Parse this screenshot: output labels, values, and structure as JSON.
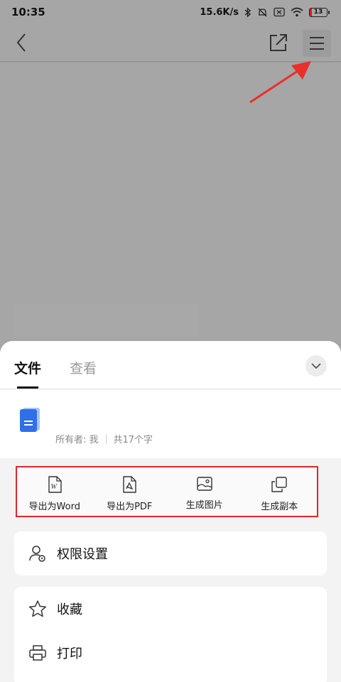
{
  "status_bar": {
    "time": "10:35",
    "network_speed": "15.6K/s",
    "battery_level": "13",
    "battery_color": "#d32020"
  },
  "top_bar": {
    "icons": [
      "back-icon",
      "share-external-icon",
      "menu-icon"
    ]
  },
  "sheet": {
    "tabs": [
      {
        "label": "文件",
        "active": true
      },
      {
        "label": "查看",
        "active": false
      }
    ],
    "doc": {
      "owner": "所有者: 我",
      "word_count": "共17个字",
      "icon_color": "#2f6fe8"
    },
    "actions": [
      {
        "label": "导出为Word",
        "icon": "word-file-icon"
      },
      {
        "label": "导出为PDF",
        "icon": "pdf-file-icon"
      },
      {
        "label": "生成图片",
        "icon": "image-icon"
      },
      {
        "label": "生成副本",
        "icon": "copy-icon"
      }
    ],
    "permissions_label": "权限设置",
    "list": [
      {
        "label": "收藏",
        "icon": "star-icon"
      },
      {
        "label": "打印",
        "icon": "printer-icon"
      }
    ]
  },
  "colors": {
    "highlight_border": "#e0262b",
    "arrow": "#e8302c"
  }
}
